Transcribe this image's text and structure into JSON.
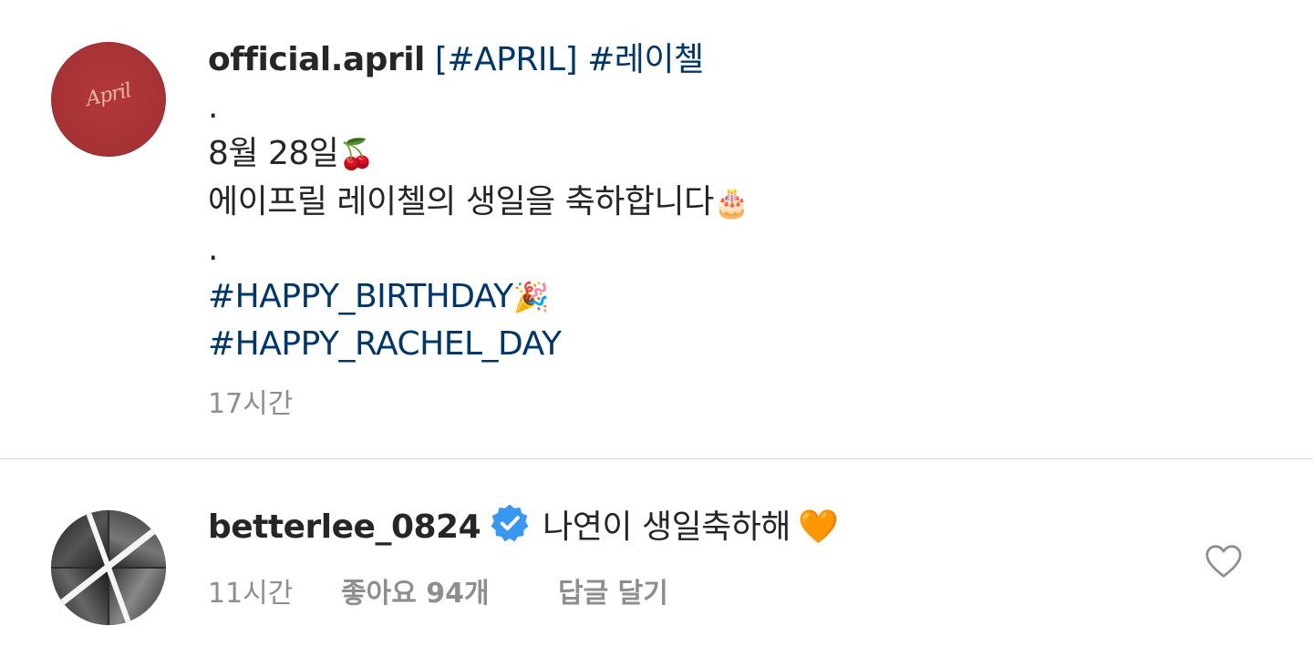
{
  "post": {
    "username": "official.april",
    "tag_april": "[#APRIL]",
    "tag_rachel": "#레이첼",
    "dot1": ".",
    "date_line": "8월 28일",
    "date_emoji": "🍒",
    "message": "에이프릴 레이첼의 생일을 축하합니다",
    "message_emoji": "🎂",
    "dot2": ".",
    "hashtag1": "#HAPPY_BIRTHDAY",
    "hashtag1_emoji": "🎉",
    "hashtag2": "#HAPPY_RACHEL_DAY",
    "time": "17시간",
    "avatar_logo": "April",
    "avatar_color": "#a53235"
  },
  "comment": {
    "username": "betterlee_0824",
    "text": "나연이 생일축하해",
    "emoji": "🧡",
    "time": "11시간",
    "likes": "좋아요 94개",
    "reply": "답글 달기",
    "verified_color": "#3897f0",
    "like_icon": "heart-outline-icon"
  }
}
